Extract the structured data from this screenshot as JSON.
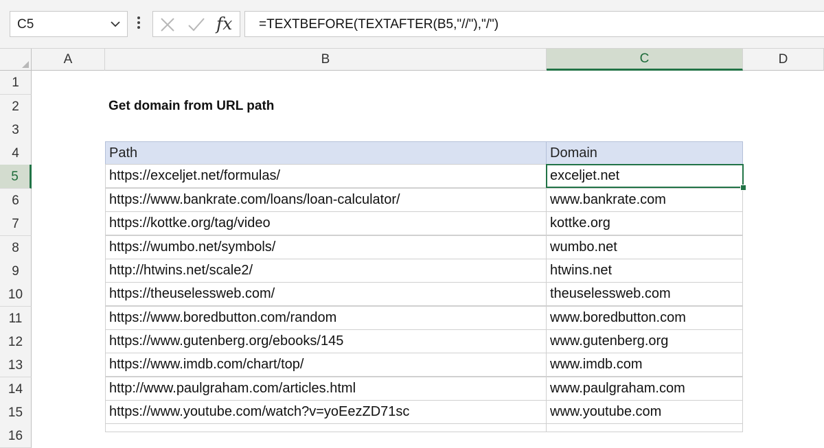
{
  "formula_bar": {
    "name_box": "C5",
    "fx_label": "fx",
    "formula": "=TEXTBEFORE(TEXTAFTER(B5,\"//\"),\"/\")"
  },
  "columns": [
    "A",
    "B",
    "C",
    "D"
  ],
  "selected_column": "C",
  "rows": [
    "1",
    "2",
    "3",
    "4",
    "5",
    "6",
    "7",
    "8",
    "9",
    "10",
    "11",
    "12",
    "13",
    "14",
    "15",
    "16"
  ],
  "selected_row": "5",
  "sheet": {
    "title": "Get domain from URL path",
    "headers": {
      "path": "Path",
      "domain": "Domain"
    },
    "data": [
      {
        "path": "https://exceljet.net/formulas/",
        "domain": "exceljet.net"
      },
      {
        "path": "https://www.bankrate.com/loans/loan-calculator/",
        "domain": "www.bankrate.com"
      },
      {
        "path": "https://kottke.org/tag/video",
        "domain": "kottke.org"
      },
      {
        "path": "https://wumbo.net/symbols/",
        "domain": "wumbo.net"
      },
      {
        "path": "http://htwins.net/scale2/",
        "domain": "htwins.net"
      },
      {
        "path": "https://theuselessweb.com/",
        "domain": "theuselessweb.com"
      },
      {
        "path": "https://www.boredbutton.com/random",
        "domain": "www.boredbutton.com"
      },
      {
        "path": "https://www.gutenberg.org/ebooks/145",
        "domain": "www.gutenberg.org"
      },
      {
        "path": "https://www.imdb.com/chart/top/",
        "domain": "www.imdb.com"
      },
      {
        "path": "http://www.paulgraham.com/articles.html",
        "domain": "www.paulgraham.com"
      },
      {
        "path": "https://www.youtube.com/watch?v=yoEezZD71sc",
        "domain": "www.youtube.com"
      }
    ]
  },
  "colors": {
    "accent": "#217346",
    "header_fill": "#D9E1F2"
  }
}
